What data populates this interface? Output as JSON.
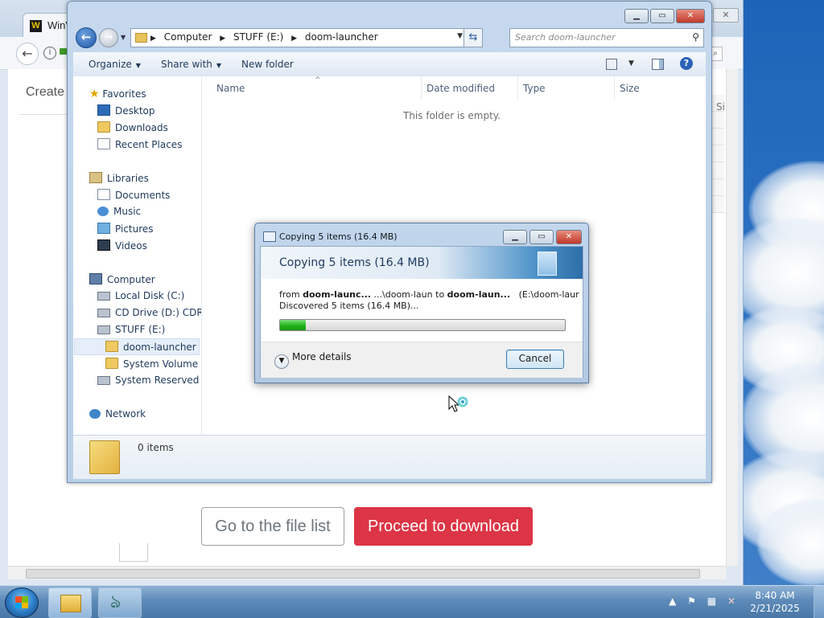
{
  "browser": {
    "tab_title": "WinV",
    "favicon": "W",
    "page_heading": "Create",
    "right_column_label": "Si",
    "back_icon": "arrow-left-icon",
    "buttons": {
      "file_list": "Go to the file list",
      "proceed": "Proceed to download"
    },
    "colors": {
      "proceed_bg": "#dc3545"
    }
  },
  "explorer": {
    "address": [
      "Computer",
      "STUFF (E:)",
      "doom-launcher"
    ],
    "search_placeholder": "Search doom-launcher",
    "toolbar": {
      "organize": "Organize",
      "share_with": "Share with",
      "new_folder": "New folder"
    },
    "nav": {
      "favorites": "Favorites",
      "desktop": "Desktop",
      "downloads": "Downloads",
      "recent_places": "Recent Places",
      "libraries": "Libraries",
      "documents": "Documents",
      "music": "Music",
      "pictures": "Pictures",
      "videos": "Videos",
      "computer": "Computer",
      "local_disk": "Local Disk (C:)",
      "cd_drive": "CD Drive (D:) CDROM",
      "stuff": "STUFF (E:)",
      "doom_launcher": "doom-launcher",
      "system_volume": "System Volume Info",
      "system_reserved": "System Reserved (Z:)",
      "network": "Network"
    },
    "columns": {
      "name": "Name",
      "date_modified": "Date modified",
      "type": "Type",
      "size": "Size"
    },
    "empty_message": "This folder is empty.",
    "item_count": "0 items"
  },
  "copy_dialog": {
    "title": "Copying 5 items (16.4 MB)",
    "heading": "Copying 5 items (16.4 MB)",
    "from_label": "from",
    "from_name": "doom-launc...",
    "from_path": "...\\doom-laun",
    "to_label": "to",
    "to_name": "doom-laun...",
    "to_path": "(E:\\doom-laur",
    "status": "Discovered 5 items (16.4 MB)...",
    "progress": 0.09,
    "more_details": "More details",
    "cancel": "Cancel"
  },
  "taskbar": {
    "time": "8:40 AM",
    "date": "2/21/2025"
  }
}
